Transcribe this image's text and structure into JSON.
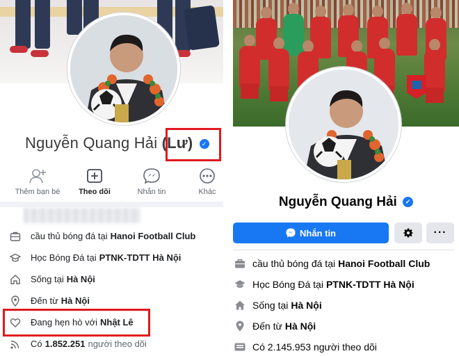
{
  "left": {
    "profile_name": "Nguyễn Quang Hải",
    "name_suffix": "(Lư)",
    "actions": [
      {
        "label": "Thêm bạn bè",
        "icon": "add-friend-icon"
      },
      {
        "label": "Theo dõi",
        "icon": "follow-icon"
      },
      {
        "label": "Nhắn tin",
        "icon": "messenger-icon"
      },
      {
        "label": "Khác",
        "icon": "more-icon"
      }
    ],
    "info": [
      {
        "icon": "briefcase-icon",
        "text": "cầu thủ bóng đá tại",
        "bold": "Hanoi Football Club"
      },
      {
        "icon": "graduation-cap-icon",
        "text": "Học Bóng Đá tại",
        "bold": "PTNK-TDTT Hà Nội"
      },
      {
        "icon": "home-icon",
        "text": "Sống tại",
        "bold": "Hà Nội"
      },
      {
        "icon": "location-icon",
        "text": "Đến từ",
        "bold": "Hà Nội"
      },
      {
        "icon": "heart-icon",
        "text": "Đang hẹn hò với",
        "bold": "Nhật Lê"
      },
      {
        "icon": "rss-icon",
        "text": "Có",
        "bold": "1.852.251",
        "after": "người theo dõi"
      }
    ]
  },
  "right": {
    "profile_name": "Nguyễn Quang Hải",
    "message_button": "Nhắn tin",
    "info": [
      {
        "icon": "briefcase-icon",
        "text": "cầu thủ bóng đá tại",
        "bold": "Hanoi Football Club"
      },
      {
        "icon": "graduation-cap-icon",
        "text": "Học Bóng Đá tại",
        "bold": "PTNK-TDTT Hà Nội"
      },
      {
        "icon": "home-icon",
        "text": "Sống tại",
        "bold": "Hà Nội"
      },
      {
        "icon": "location-icon",
        "text": "Đến từ",
        "bold": "Hà Nội"
      },
      {
        "icon": "followers-icon",
        "text": "Có 2.145.953 người theo dõi"
      }
    ]
  },
  "colors": {
    "facebook_blue": "#1877f2",
    "highlight_red": "#e0191e",
    "secondary_button": "#e4e6eb"
  }
}
